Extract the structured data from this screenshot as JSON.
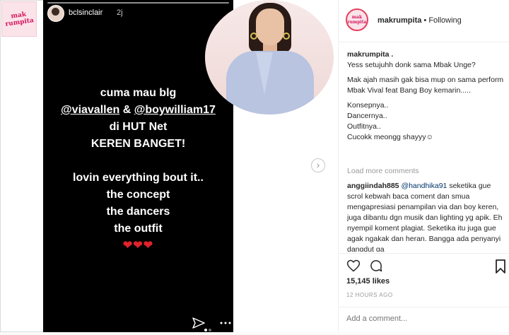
{
  "corner_logo": {
    "text": "mak rumpita"
  },
  "story": {
    "username": "bclsinclair",
    "time": "2j",
    "lines": [
      "cuma mau blg",
      "@viavallen & @boywilliam17",
      "di HUT Net",
      "KEREN BANGET!",
      "",
      "lovin everything bout it..",
      "the concept",
      "the dancers",
      "the outfit"
    ],
    "mention_1": "@viavallen",
    "mention_amp": " & ",
    "mention_2": "@boywilliam17",
    "hearts": "❤❤❤"
  },
  "post": {
    "avatar_text": "mak rumpita",
    "username": "makrumpita",
    "follow_status": " • Following",
    "caption_user": "makrumpita .",
    "caption_lines": [
      "Yess setujuhh donk sama Mbak Unge?",
      "",
      "Mak ajah masih gak bisa mup on sama perform Mbak Vival feat Bang Boy kemarin.....",
      "",
      "Konsepnya..",
      "Dancernya..",
      "Outfitnya..",
      "Cucokk meongg shayyy☺"
    ],
    "load_more": "Load more comments",
    "comment": {
      "user": "anggiindah885",
      "mention": "@handhika91",
      "text": " seketika gue scrol kebwah baca coment dan smua mengapresiasi penampilan via dan boy keren, juga dibantu dgn musik dan lighting yg apik. Eh nyempil koment plagiat. Seketika itu juga gue agak ngakak dan heran. Bangga ada penyanyi dangdut ga"
    },
    "likes": "15,145 likes",
    "time_ago": "12 HOURS AGO",
    "add_comment_placeholder": "Add a comment..."
  },
  "colors": {
    "story_bg": "#000000",
    "heart": "#e0222a",
    "mention": "#003569",
    "brand": "#d4145a"
  }
}
